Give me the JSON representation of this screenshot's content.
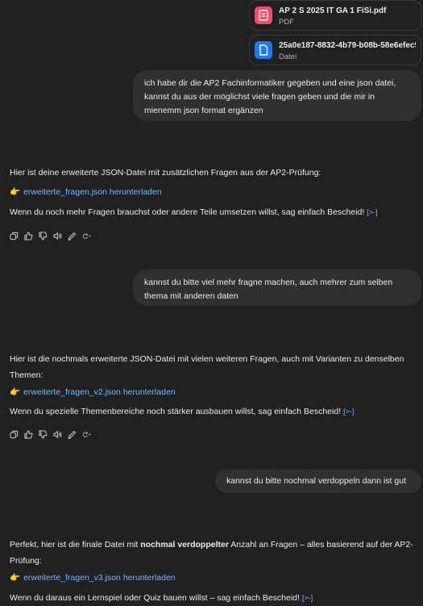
{
  "attachments": [
    {
      "name": "AP 2 S 2025 IT GA 1 FiSi.pdf",
      "type": "PDF",
      "color": "#f04d6a",
      "icon": "document-icon"
    },
    {
      "name": "25a0e187-8832-4b79-b08b-58e6efec5...",
      "type": "Datei",
      "color": "#1d7af0",
      "icon": "file-icon"
    }
  ],
  "messages": {
    "user1": "ich habe dir die AP2 Fachinformatiker gegeben und eine json datei, kannst du aus der möglichst viele fragen geben und die mir in mienemm json format ergänzen",
    "assistant1": {
      "intro": "Hier ist deine erweiterte JSON-Datei mit zusätzlichen Fragen aus der AP2-Prüfung:",
      "link_icon": "👉",
      "link": "erweiterte_fragen.json herunterladen",
      "outro": "Wenn du noch mehr Fragen brauchst oder andere Teile umsetzen willst, sag einfach Bescheid!",
      "source": "[>-]"
    },
    "user2": "kannst du bitte viel mehr fragne machen, auch mehrer zum selben thema mit anderen daten",
    "assistant2": {
      "intro": "Hier ist die nochmals erweiterte JSON-Datei mit vielen weiteren Fragen, auch mit Varianten zu denselben Themen:",
      "link_icon": "👉",
      "link": "erweiterte_fragen_v2.json herunterladen",
      "outro": "Wenn du spezielle Themenbereiche noch stärker ausbauen willst, sag einfach Bescheid!",
      "source": "[>-]"
    },
    "user3": "kannst du bitte nochmal verdoppeln dann ist gut",
    "assistant3": {
      "intro_a": "Perfekt, hier ist die finale Datei mit ",
      "intro_bold": "nochmal verdoppelter",
      "intro_b": " Anzahl an Fragen – alles basierend auf der AP2-Prüfung:",
      "link_icon": "👉",
      "link": "erweiterte_fragen_v3.json herunterladen",
      "outro": "Wenn du daraus ein Lernspiel oder Quiz bauen willst – sag einfach Bescheid!",
      "source": "[>-]"
    }
  },
  "action_icons": [
    "copy-icon",
    "thumbs-up-icon",
    "thumbs-down-icon",
    "read-aloud-icon",
    "edit-icon",
    "regenerate-icon"
  ]
}
